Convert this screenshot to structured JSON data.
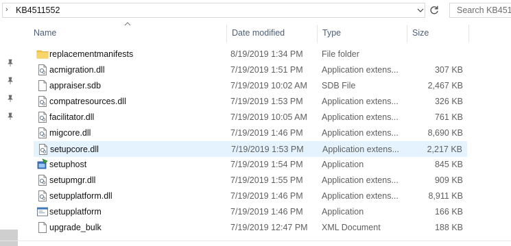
{
  "address_bar": {
    "chevron": "›",
    "path": "KB4511552"
  },
  "search": {
    "placeholder": "Search KB451"
  },
  "columns": {
    "name": "Name",
    "date": "Date modified",
    "type": "Type",
    "size": "Size"
  },
  "files": [
    {
      "name": "replacementmanifests",
      "date": "8/19/2019 1:34 PM",
      "type": "File folder",
      "size": "",
      "icon": "folder-icon"
    },
    {
      "name": "acmigration.dll",
      "date": "7/19/2019 1:51 PM",
      "type": "Application extens...",
      "size": "307 KB",
      "icon": "dll-file-icon"
    },
    {
      "name": "appraiser.sdb",
      "date": "7/19/2019 10:02 AM",
      "type": "SDB File",
      "size": "2,467 KB",
      "icon": "blank-file-icon"
    },
    {
      "name": "compatresources.dll",
      "date": "7/19/2019 1:53 PM",
      "type": "Application extens...",
      "size": "326 KB",
      "icon": "dll-file-icon"
    },
    {
      "name": "facilitator.dll",
      "date": "7/19/2019 10:05 AM",
      "type": "Application extens...",
      "size": "761 KB",
      "icon": "dll-file-icon"
    },
    {
      "name": "migcore.dll",
      "date": "7/19/2019 1:46 PM",
      "type": "Application extens...",
      "size": "8,690 KB",
      "icon": "dll-file-icon"
    },
    {
      "name": "setupcore.dll",
      "date": "7/19/2019 1:53 PM",
      "type": "Application extens...",
      "size": "2,217 KB",
      "icon": "dll-file-icon",
      "selected": true
    },
    {
      "name": "setuphost",
      "date": "7/19/2019 1:54 PM",
      "type": "Application",
      "size": "845 KB",
      "icon": "setup-app-icon"
    },
    {
      "name": "setupmgr.dll",
      "date": "7/19/2019 1:55 PM",
      "type": "Application extens...",
      "size": "909 KB",
      "icon": "dll-file-icon"
    },
    {
      "name": "setupplatform.dll",
      "date": "7/19/2019 1:46 PM",
      "type": "Application extens...",
      "size": "8,911 KB",
      "icon": "dll-file-icon"
    },
    {
      "name": "setupplatform",
      "date": "7/19/2019 1:46 PM",
      "type": "Application",
      "size": "166 KB",
      "icon": "app-window-icon"
    },
    {
      "name": "upgrade_bulk",
      "date": "7/19/2019 12:47 PM",
      "type": "XML Document",
      "size": "188 KB",
      "icon": "blank-file-icon"
    }
  ]
}
